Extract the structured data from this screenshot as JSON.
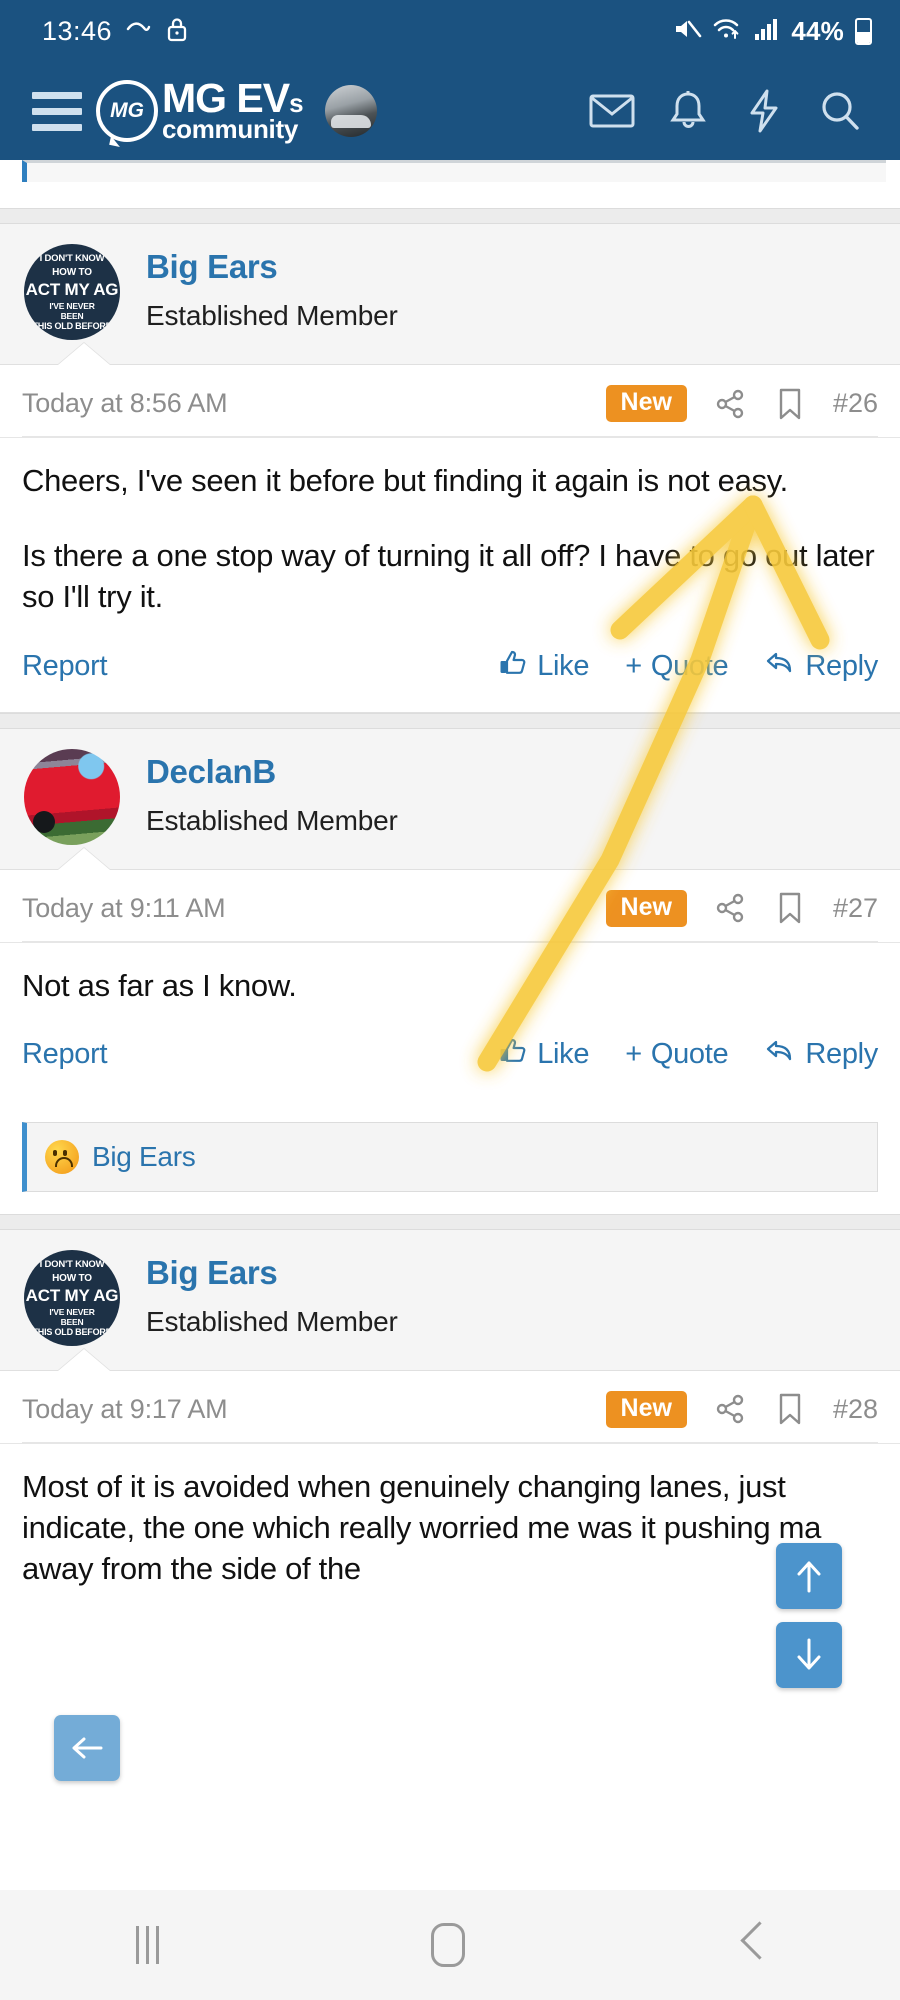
{
  "status_bar": {
    "time": "13:46",
    "battery_percent": "44%",
    "icons": [
      "weather-icon",
      "lock-icon",
      "mute-icon",
      "wifi-icon",
      "signal-icon",
      "battery-icon"
    ]
  },
  "app_bar": {
    "menu_icon": "hamburger-menu-icon",
    "logo_badge": "MG",
    "brand_line1": "MG EVs",
    "brand_line1_sub": "s",
    "brand_line2": "community",
    "avatar": "user-avatar",
    "icons": [
      "inbox-icon",
      "bell-icon",
      "bolt-icon",
      "search-icon"
    ]
  },
  "theme": {
    "header_blue": "#1b5280",
    "link_blue": "#2a74ad",
    "badge_orange": "#ed9121",
    "fab_blue": "#3e8cc8",
    "highlight_yellow": "#f7c933"
  },
  "posts": [
    {
      "author": "Big Ears",
      "title": "Established Member",
      "avatar_kind": "bigears-badge",
      "avatar_lines": [
        "I DON'T KNOW",
        "HOW TO",
        "ACT MY AG",
        "I'VE NEVER",
        "BEEN",
        "THIS OLD BEFORE"
      ],
      "date": "Today at 8:56 AM",
      "badge": "New",
      "post_number": "#26",
      "paragraphs": [
        "Cheers, I've seen it before but finding it again is not easy.",
        "Is there a one stop way of turning it all off? I have to go out later so I'll try it."
      ],
      "actions": {
        "report": "Report",
        "like": "Like",
        "quote": "Quote",
        "quote_prefix": "+",
        "reply": "Reply"
      },
      "reactions": []
    },
    {
      "author": "DeclanB",
      "title": "Established Member",
      "avatar_kind": "car-photo",
      "avatar_lines": [],
      "date": "Today at 9:11 AM",
      "badge": "New",
      "post_number": "#27",
      "paragraphs": [
        "Not as far as I know."
      ],
      "actions": {
        "report": "Report",
        "like": "Like",
        "quote": "Quote",
        "quote_prefix": "+",
        "reply": "Reply"
      },
      "reactions": [
        {
          "emoji": "sad-face-emoji",
          "name": "Big Ears"
        }
      ]
    },
    {
      "author": "Big Ears",
      "title": "Established Member",
      "avatar_kind": "bigears-badge",
      "avatar_lines": [
        "I DON'T KNOW",
        "HOW TO",
        "ACT MY AG",
        "I'VE NEVER",
        "BEEN",
        "THIS OLD BEFORE"
      ],
      "date": "Today at 9:17 AM",
      "badge": "New",
      "post_number": "#28",
      "paragraphs": [
        "Most of it is avoided when genuinely changing lanes, just indicate, the one which really worried me was it pushing ma away from the side of the"
      ],
      "actions": null,
      "reactions": []
    }
  ],
  "floating_buttons": [
    {
      "name": "scroll-up-button",
      "glyph": "↑"
    },
    {
      "name": "scroll-down-button",
      "glyph": "↓"
    },
    {
      "name": "go-back-button",
      "glyph": "←"
    }
  ],
  "annotation": {
    "type": "hand-drawn-arrow",
    "color": "#f7c933",
    "points_to": "bookmark-icon-of-post-26"
  },
  "nav_bar": {
    "recents": "recents-icon",
    "home": "home-icon",
    "back": "back-icon"
  }
}
